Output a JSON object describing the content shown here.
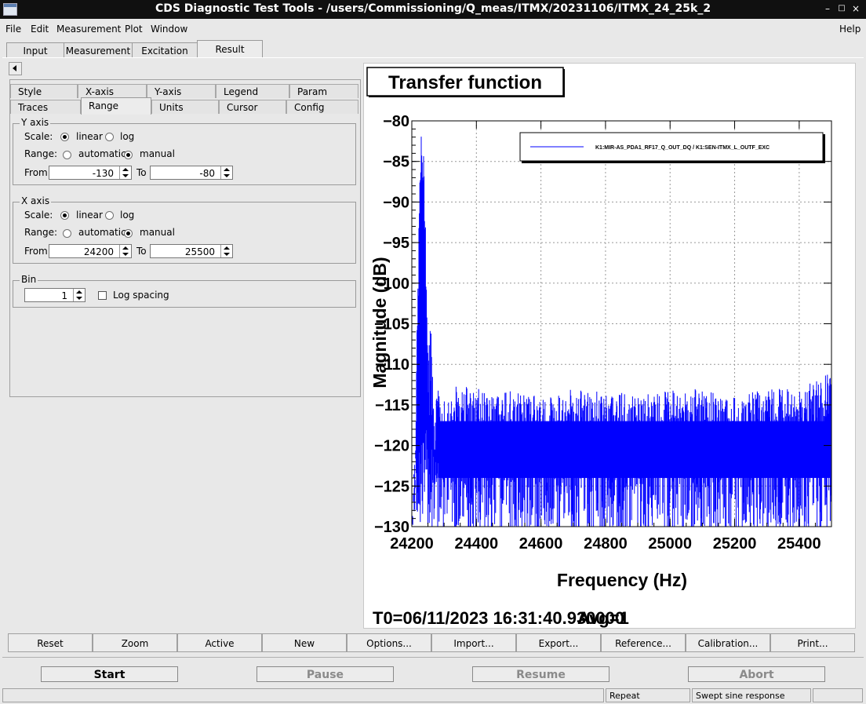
{
  "window": {
    "title": "CDS Diagnostic Test Tools - /users/Commissioning/Q_meas/ITMX/20231106/ITMX_24_25k_2"
  },
  "menubar": {
    "items": [
      {
        "label": "File"
      },
      {
        "label": "Edit"
      },
      {
        "label": "Measurement"
      },
      {
        "label": "Plot"
      },
      {
        "label": "Window"
      },
      {
        "label": "Help"
      }
    ]
  },
  "main_tabs": [
    {
      "label": "Input"
    },
    {
      "label": "Measurement"
    },
    {
      "label": "Excitation"
    },
    {
      "label": "Result"
    }
  ],
  "subtabs": {
    "row1": [
      {
        "label": "Style"
      },
      {
        "label": "X-axis"
      },
      {
        "label": "Y-axis"
      },
      {
        "label": "Legend"
      },
      {
        "label": "Param"
      }
    ],
    "row2": [
      {
        "label": "Traces"
      },
      {
        "label": "Range"
      },
      {
        "label": "Units"
      },
      {
        "label": "Cursor"
      },
      {
        "label": "Config"
      }
    ],
    "active": "Range"
  },
  "y_axis_group": {
    "title": "Y axis",
    "scale_label": "Scale:",
    "linear_label": "linear",
    "log_label": "log",
    "range_label": "Range:",
    "automatic_label": "automatic",
    "manual_label": "manual",
    "from_label": "From",
    "to_label": "To",
    "from_value": "-130",
    "to_value": "-80",
    "scale_selected": "linear",
    "range_selected": "manual"
  },
  "x_axis_group": {
    "title": "X axis",
    "scale_label": "Scale:",
    "linear_label": "linear",
    "log_label": "log",
    "range_label": "Range:",
    "automatic_label": "automatic",
    "manual_label": "manual",
    "from_label": "From",
    "to_label": "To",
    "from_value": "24200",
    "to_value": "25500",
    "scale_selected": "linear",
    "range_selected": "manual"
  },
  "bin_group": {
    "title": "Bin",
    "value": "1",
    "log_spacing_label": "Log spacing",
    "log_spacing_checked": false
  },
  "plot": {
    "title": "Transfer function",
    "footer": "T0=06/11/2023 16:31:40.930000",
    "footer_overlap": "Avg=1",
    "trace_color": "#0000ff"
  },
  "chart_data": {
    "type": "line",
    "title": "Transfer function",
    "xlabel": "Frequency (Hz)",
    "ylabel": "Magnitude (dB)",
    "xlim": [
      24200,
      25500
    ],
    "ylim": [
      -130,
      -80
    ],
    "xticks": [
      "24200",
      "24400",
      "24600",
      "24800",
      "25000",
      "25200",
      "25400"
    ],
    "yticks": [
      "−80",
      "−85",
      "−90",
      "−95",
      "−100",
      "−105",
      "−110",
      "−115",
      "−120",
      "−125",
      "−130"
    ],
    "grid": true,
    "legend_position": "top-right",
    "series": [
      {
        "name": "K1:MIR-AS_PDA1_RF17_Q_OUT_DQ / K1:SEN-ITMX_L_OUTF_EXC",
        "color": "#0000ff",
        "x": [
          24200,
          24210,
          24220,
          24225,
          24230,
          24235,
          24240,
          24245,
          24250,
          24260,
          24270,
          24280,
          24300,
          24350,
          24400,
          24500,
          24600,
          24700,
          24800,
          24900,
          25000,
          25100,
          25200,
          25300,
          25400,
          25500
        ],
        "y": [
          -128,
          -122,
          -100,
          -88,
          -84,
          -86,
          -90,
          -100,
          -112,
          -106,
          -118,
          -116,
          -117,
          -115,
          -116,
          -116,
          -117,
          -116,
          -116,
          -117,
          -116,
          -116,
          -117,
          -116,
          -116,
          -114
        ],
        "noise_floor": [
          -130,
          -112
        ]
      }
    ]
  },
  "bottom_buttons": [
    {
      "label": "Reset"
    },
    {
      "label": "Zoom"
    },
    {
      "label": "Active"
    },
    {
      "label": "New"
    },
    {
      "label": "Options..."
    },
    {
      "label": "Import..."
    },
    {
      "label": "Export..."
    },
    {
      "label": "Reference..."
    },
    {
      "label": "Calibration..."
    },
    {
      "label": "Print..."
    }
  ],
  "run_buttons": [
    {
      "label": "Start",
      "enabled": true
    },
    {
      "label": "Pause",
      "enabled": false
    },
    {
      "label": "Resume",
      "enabled": false
    },
    {
      "label": "Abort",
      "enabled": false
    }
  ],
  "status": {
    "left": "",
    "mode": "Repeat",
    "type": "Swept sine response",
    "extra": ""
  }
}
